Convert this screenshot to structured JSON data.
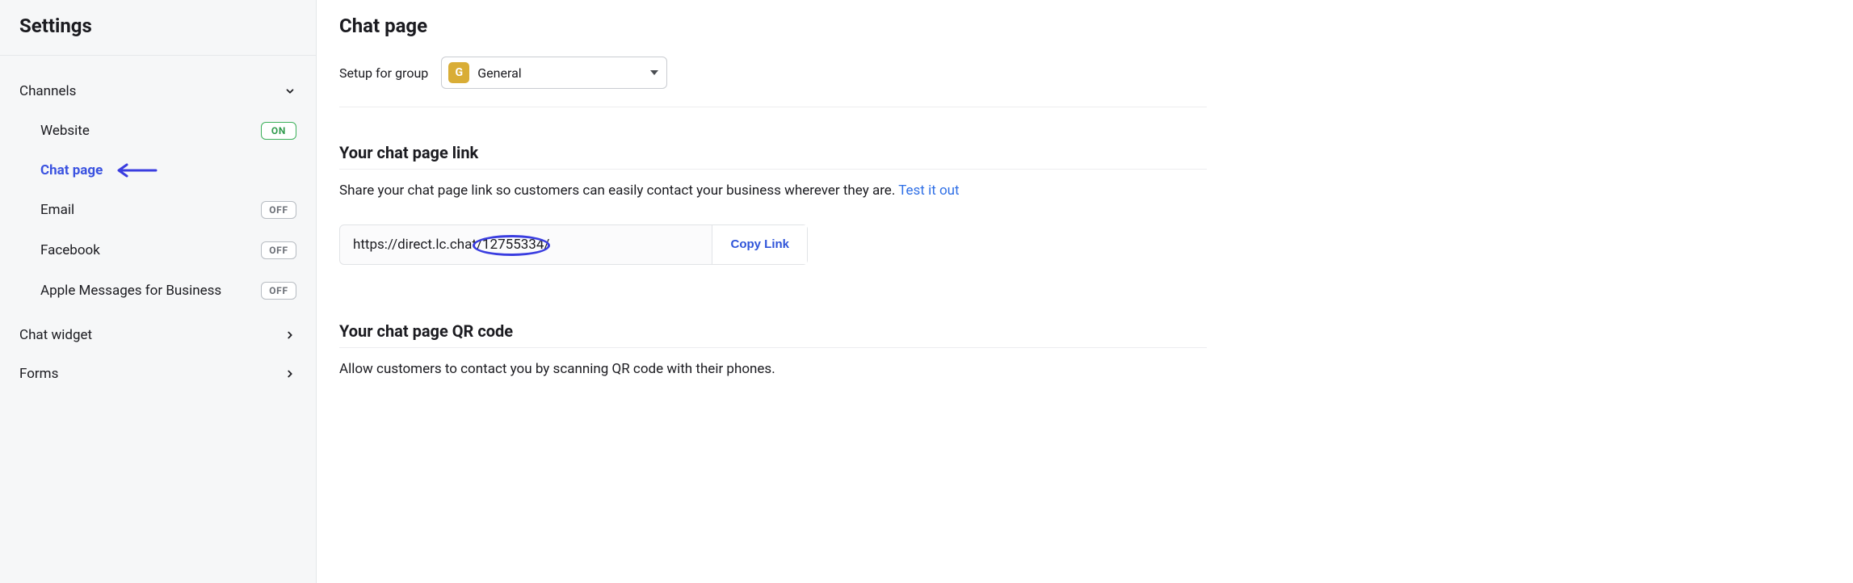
{
  "sidebar": {
    "title": "Settings",
    "sections": {
      "channels": {
        "label": "Channels",
        "items": [
          {
            "label": "Website",
            "status": "ON",
            "active": false
          },
          {
            "label": "Chat page",
            "status": "",
            "active": true
          },
          {
            "label": "Email",
            "status": "OFF",
            "active": false
          },
          {
            "label": "Facebook",
            "status": "OFF",
            "active": false
          },
          {
            "label": "Apple Messages for Business",
            "status": "OFF",
            "active": false
          }
        ]
      },
      "chat_widget": {
        "label": "Chat widget"
      },
      "forms": {
        "label": "Forms"
      }
    }
  },
  "main": {
    "title": "Chat page",
    "group": {
      "setup_label": "Setup for group",
      "avatar_letter": "G",
      "selected": "General"
    },
    "section_link": {
      "title": "Your chat page link",
      "desc_prefix": "Share your chat page link so customers can easily contact your business wherever they are. ",
      "test_link": "Test it out",
      "url": "https://direct.lc.chat/12755334/",
      "copy_label": "Copy Link"
    },
    "section_qr": {
      "title": "Your chat page QR code",
      "desc": "Allow customers to contact you by scanning QR code with their phones."
    }
  }
}
